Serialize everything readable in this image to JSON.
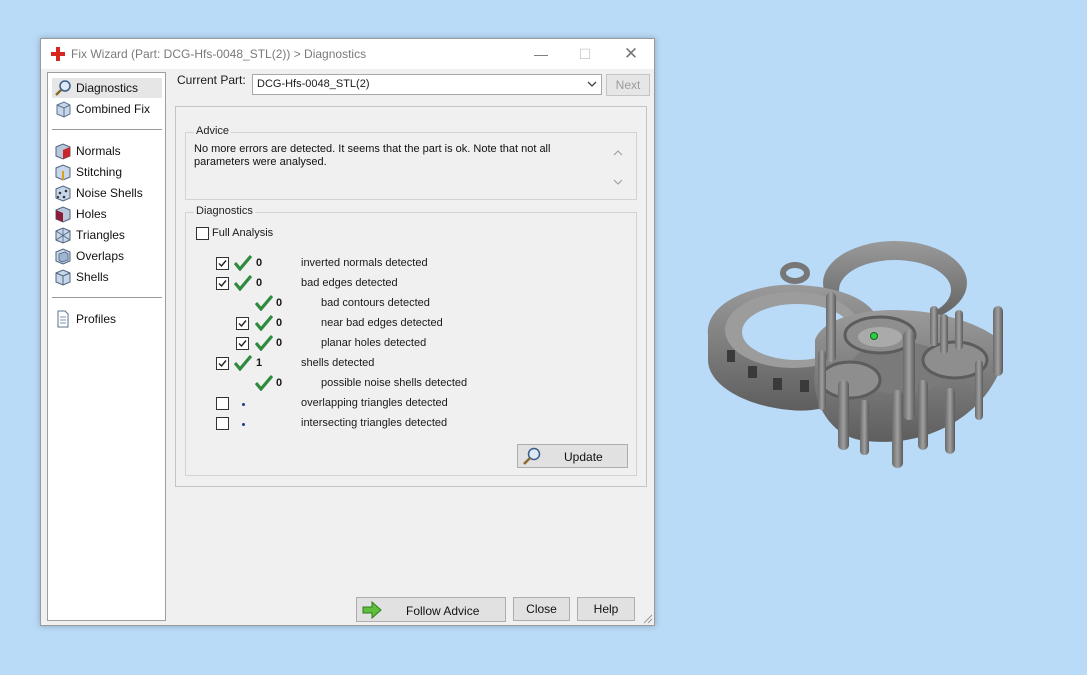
{
  "window": {
    "title": "Fix Wizard (Part: DCG-Hfs-0048_STL(2)) > Diagnostics",
    "controls": {
      "minimize": "—",
      "maximize": "☐",
      "close": "✕"
    }
  },
  "sidebar": {
    "items": [
      {
        "label": "Diagnostics",
        "icon": "magnifier-icon",
        "active": true
      },
      {
        "label": "Combined Fix",
        "icon": "cube-stack-icon"
      },
      {
        "label": "Normals",
        "icon": "normals-cube-icon"
      },
      {
        "label": "Stitching",
        "icon": "stitching-cube-icon"
      },
      {
        "label": "Noise Shells",
        "icon": "noise-shells-icon"
      },
      {
        "label": "Holes",
        "icon": "holes-cube-icon"
      },
      {
        "label": "Triangles",
        "icon": "triangles-cube-icon"
      },
      {
        "label": "Overlaps",
        "icon": "overlaps-cube-icon"
      },
      {
        "label": "Shells",
        "icon": "shells-cube-icon"
      },
      {
        "label": "Profiles",
        "icon": "document-icon"
      }
    ]
  },
  "current_part": {
    "label": "Current Part:",
    "value": "DCG-Hfs-0048_STL(2)",
    "next_button": "Next"
  },
  "advice": {
    "title": "Advice",
    "text": "No more errors are detected. It seems that the part is ok. Note that not all parameters were analysed."
  },
  "diagnostics": {
    "title": "Diagnostics",
    "full_analysis_label": "Full Analysis",
    "full_analysis_checked": false,
    "rows": [
      {
        "has_checkbox": true,
        "checked": true,
        "status": "ok",
        "count": "0",
        "label": "inverted normals detected",
        "indent": 0
      },
      {
        "has_checkbox": true,
        "checked": true,
        "status": "ok",
        "count": "0",
        "label": "bad edges detected",
        "indent": 0
      },
      {
        "has_checkbox": false,
        "checked": false,
        "status": "ok",
        "count": "0",
        "label": "bad contours detected",
        "indent": 1
      },
      {
        "has_checkbox": true,
        "checked": true,
        "status": "ok",
        "count": "0",
        "label": "near bad edges detected",
        "indent": 1
      },
      {
        "has_checkbox": true,
        "checked": true,
        "status": "ok",
        "count": "0",
        "label": "planar holes detected",
        "indent": 1
      },
      {
        "has_checkbox": true,
        "checked": true,
        "status": "ok",
        "count": "1",
        "label": "shells detected",
        "indent": 0
      },
      {
        "has_checkbox": false,
        "checked": false,
        "status": "ok",
        "count": "0",
        "label": "possible noise shells detected",
        "indent": 1
      },
      {
        "has_checkbox": true,
        "checked": false,
        "status": "pending",
        "count": "",
        "label": "overlapping triangles detected",
        "indent": 0
      },
      {
        "has_checkbox": true,
        "checked": false,
        "status": "pending",
        "count": "",
        "label": "intersecting triangles detected",
        "indent": 0
      }
    ],
    "update_button": "Update"
  },
  "footer": {
    "follow_advice": "Follow Advice",
    "close": "Close",
    "help": "Help"
  },
  "colors": {
    "desktop": "#b9dbf7",
    "check_green": "#2e8b3e",
    "app_icon_red": "#d7281f",
    "model_gray": "#8a8a8a"
  }
}
